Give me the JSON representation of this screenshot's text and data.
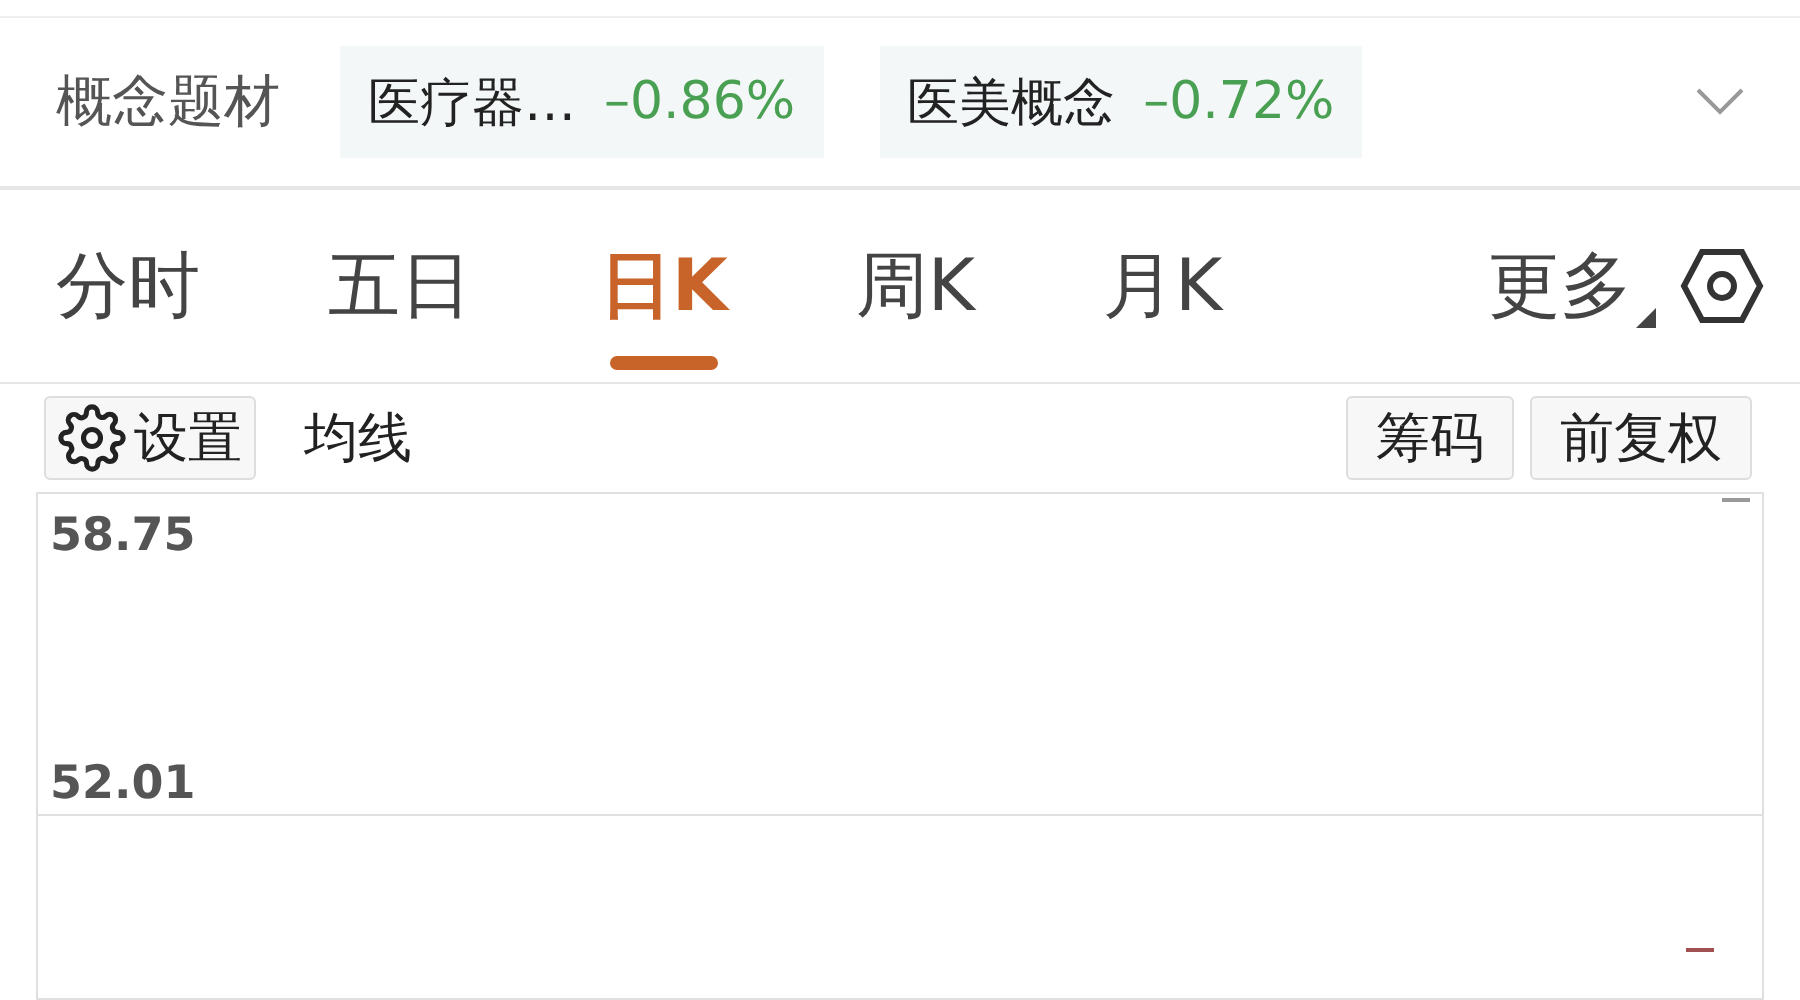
{
  "concepts": {
    "label": "概念题材",
    "tags": [
      {
        "name": "医疗器…",
        "change": "–0.86%"
      },
      {
        "name": "医美概念",
        "change": "–0.72%"
      }
    ]
  },
  "tabs": [
    {
      "label": "分时",
      "selected": false
    },
    {
      "label": "五日",
      "selected": false
    },
    {
      "label": "日K",
      "selected": true
    },
    {
      "label": "周K",
      "selected": false
    },
    {
      "label": "月K",
      "selected": false
    }
  ],
  "more_tab": {
    "label": "更多"
  },
  "toolbar": {
    "settings": "设置",
    "ma": "均线",
    "buttons": [
      "筹码",
      "前复权"
    ]
  },
  "chart": {
    "price_labels": [
      "58.75",
      "52.01"
    ]
  }
}
